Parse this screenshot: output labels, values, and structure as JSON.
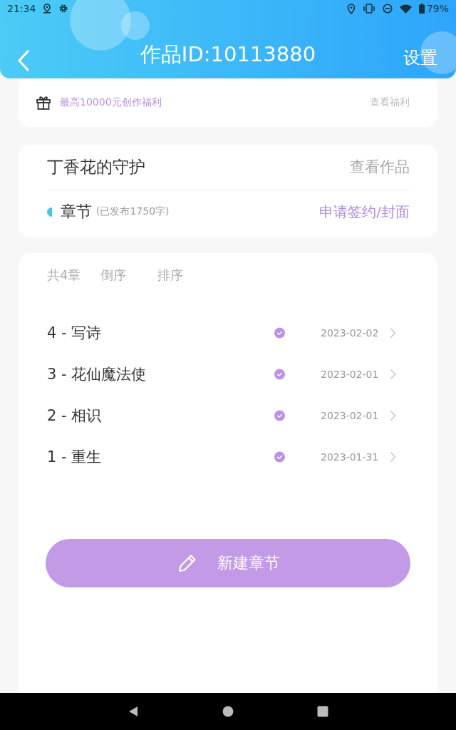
{
  "status_bar": {
    "time": "21:34",
    "battery": "79%"
  },
  "header": {
    "title": "作品ID:10113880",
    "action": "设置"
  },
  "benefit": {
    "text": "最高10000元创作福利",
    "link": "查看福利"
  },
  "work": {
    "title": "丁香花的守护",
    "view": "查看作品",
    "section": "章节",
    "published_note": "(已发布1750字)",
    "apply": "申请签约/封面"
  },
  "chapters": {
    "count": "共4章",
    "reverse": "倒序",
    "sort": "排序",
    "items": [
      {
        "title": "4 - 写诗",
        "published": true,
        "date": "2023-02-02"
      },
      {
        "title": "3 - 花仙魔法使",
        "published": true,
        "date": "2023-02-01"
      },
      {
        "title": "2 - 相识",
        "published": true,
        "date": "2023-02-01"
      },
      {
        "title": "1 - 重生",
        "published": true,
        "date": "2023-01-31"
      }
    ],
    "new_button": "新建章节"
  }
}
